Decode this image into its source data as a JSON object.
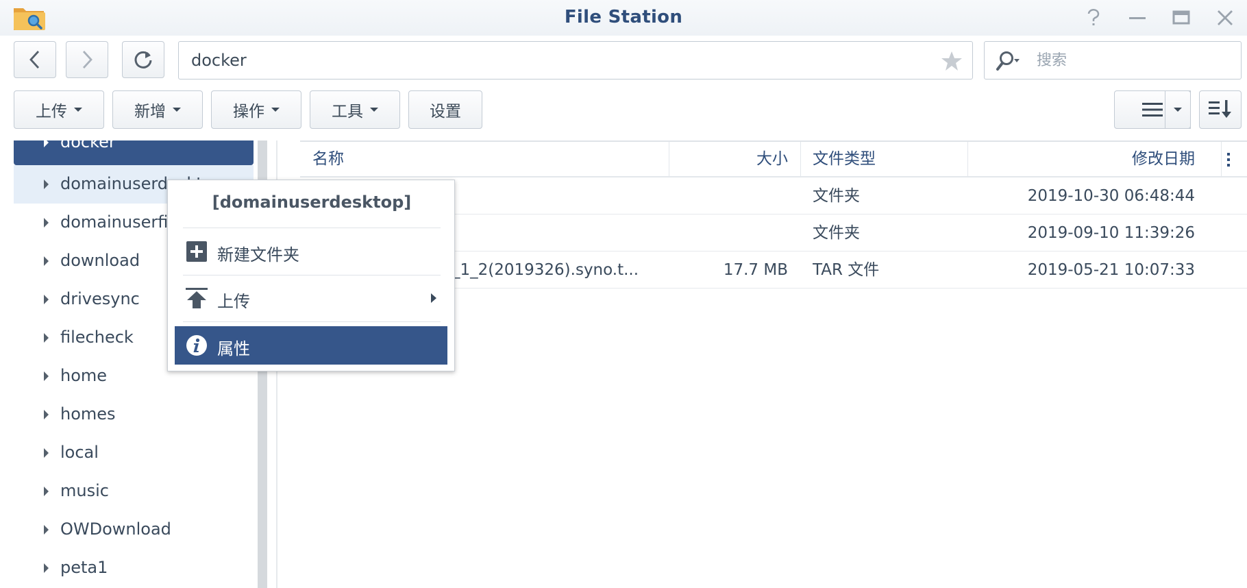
{
  "window": {
    "title": "File Station",
    "icon": "folder-search-icon",
    "controls": [
      "help-icon",
      "minimize-icon",
      "maximize-icon",
      "close-icon"
    ]
  },
  "navigation": {
    "path": "docker",
    "search_placeholder": "搜索"
  },
  "toolbar": {
    "upload_label": "上传",
    "create_label": "新增",
    "action_label": "操作",
    "tools_label": "工具",
    "settings_label": "设置"
  },
  "sidebar": {
    "items": [
      {
        "label": "docker"
      },
      {
        "label": "domainuserdesktop"
      },
      {
        "label": "domainuserfi"
      },
      {
        "label": "download"
      },
      {
        "label": "drivesync"
      },
      {
        "label": "filecheck"
      },
      {
        "label": "home"
      },
      {
        "label": "homes"
      },
      {
        "label": "local"
      },
      {
        "label": "music"
      },
      {
        "label": "OWDownload"
      },
      {
        "label": "peta1"
      }
    ]
  },
  "filelist": {
    "columns": {
      "name": "名称",
      "size": "大小",
      "type": "文件类型",
      "modified": "修改日期"
    },
    "rows": [
      {
        "name": "",
        "size": "",
        "type": "文件夹",
        "modified": "2019-10-30 06:48:44"
      },
      {
        "name": "",
        "size": "",
        "type": "文件夹",
        "modified": "2019-09-10 11:39:26"
      },
      {
        "name": "_1_2(2019326).syno.t...",
        "size": "17.7 MB",
        "type": "TAR 文件",
        "modified": "2019-05-21 10:07:33"
      }
    ]
  },
  "context_menu": {
    "title": "[domainuserdesktop]",
    "items": [
      {
        "label": "新建文件夹",
        "icon": "new-folder-icon"
      },
      {
        "label": "上传",
        "icon": "upload-icon"
      },
      {
        "label": "属性",
        "icon": "info-icon"
      }
    ]
  },
  "colors": {
    "accent": "#36568a",
    "title": "#2f4e7b"
  }
}
